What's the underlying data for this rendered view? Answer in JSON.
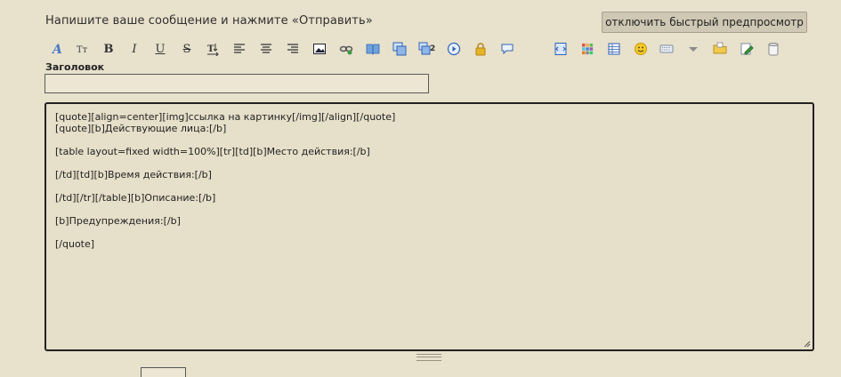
{
  "header": {
    "prompt": "Напишите ваше сообщение и нажмите «Отправить»",
    "preview_button": "отключить быстрый предпросмотр"
  },
  "toolbar": {
    "buttons": [
      {
        "icon": "italic-font-icon"
      },
      {
        "icon": "font-size-icon"
      },
      {
        "label": "B",
        "icon": "bold-icon"
      },
      {
        "label": "I",
        "icon": "italic-icon"
      },
      {
        "label": "U",
        "icon": "underline-icon"
      },
      {
        "label": "S",
        "icon": "strikethrough-icon"
      },
      {
        "icon": "text-direction-icon"
      },
      {
        "icon": "align-left-icon"
      },
      {
        "icon": "align-center-icon"
      },
      {
        "icon": "align-right-icon"
      },
      {
        "icon": "image-icon"
      },
      {
        "icon": "link-icon"
      },
      {
        "icon": "book-icon"
      },
      {
        "icon": "quote-icon"
      },
      {
        "icon": "quote-2-icon"
      },
      {
        "icon": "media-play-icon"
      },
      {
        "icon": "lock-icon"
      },
      {
        "icon": "speech-bubble-icon"
      },
      {
        "icon": "code-icon"
      },
      {
        "icon": "color-palette-icon"
      },
      {
        "icon": "table-icon"
      },
      {
        "icon": "smiley-icon"
      },
      {
        "icon": "keyboard-icon"
      },
      {
        "icon": "dropdown-arrow-icon"
      },
      {
        "icon": "folder-icon"
      },
      {
        "icon": "edit-icon"
      },
      {
        "icon": "trash-icon"
      }
    ]
  },
  "form": {
    "title_label": "Заголовок",
    "title_value": "",
    "body_lines": [
      "[quote][align=center][img]ссылка на картинку[/img][/align][/quote]",
      "[quote][b]Действующие лица:[/b]",
      "",
      "[table layout=fixed width=100%][tr][td][b]Место действия:[/b]",
      "",
      "[/td][td][b]Время действия:[/b]",
      "",
      "[/td][/tr][/table][b]Описание:[/b]",
      "",
      "[b]Предупреждения:[/b]",
      "",
      "[/quote]"
    ]
  },
  "colors": {
    "background": "#e8e1cc",
    "textarea_bg": "#e6dfc9",
    "button_bg": "#cfc8b4",
    "accent_blue": "#2f63b4",
    "lock_gold": "#d9a21b"
  }
}
